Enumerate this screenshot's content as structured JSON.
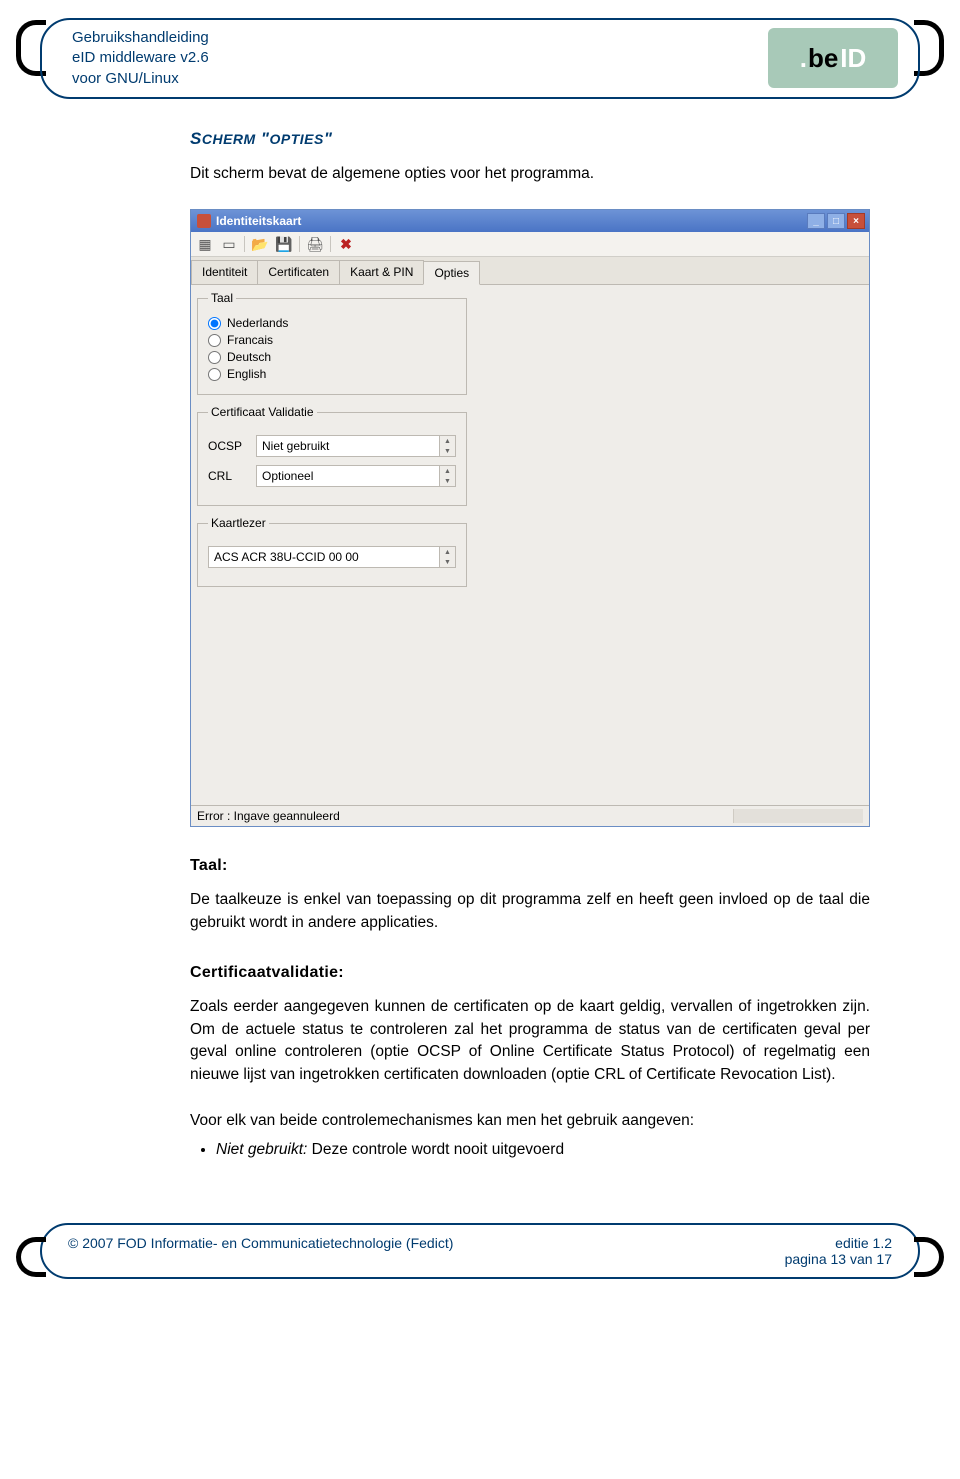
{
  "header": {
    "line1": "Gebruikshandleiding",
    "line2": "eID middleware v2.6",
    "line3": "voor GNU/Linux",
    "logo_be": "be",
    "logo_id": "ID",
    "logo_dot": "."
  },
  "section": {
    "title_caps": "S",
    "title_rest_sc": "CHERM",
    "title_quote": " \"",
    "title_opt_caps": "OPTIES",
    "title_endquote": "\"",
    "intro": "Dit scherm bevat de algemene opties voor het programma."
  },
  "app": {
    "title": "Identiteitskaart",
    "winbtn_min": "_",
    "winbtn_max": "□",
    "winbtn_close": "×",
    "tabs": [
      "Identiteit",
      "Certificaten",
      "Kaart & PIN",
      "Opties"
    ],
    "active_tab_index": 3,
    "groups": {
      "taal": {
        "legend": "Taal",
        "options": [
          "Nederlands",
          "Francais",
          "Deutsch",
          "English"
        ],
        "selected_index": 0
      },
      "certval": {
        "legend": "Certificaat Validatie",
        "rows": [
          {
            "label": "OCSP",
            "value": "Niet gebruikt"
          },
          {
            "label": "CRL",
            "value": "Optioneel"
          }
        ]
      },
      "reader": {
        "legend": "Kaartlezer",
        "value": "ACS ACR 38U-CCID 00 00"
      }
    },
    "statusbar": "Error : Ingave geannuleerd"
  },
  "body": {
    "taal_heading": "Taal:",
    "taal_text": "De taalkeuze is enkel van toepassing op dit programma zelf en heeft geen invloed op de taal die gebruikt wordt in andere applicaties.",
    "cert_heading": "Certificaatvalidatie:",
    "cert_p1": "Zoals eerder aangegeven kunnen de certificaten op de kaart geldig, vervallen of ingetrokken zijn. Om de actuele status te controleren zal het programma de status van de certificaten geval per geval online controleren (optie OCSP of Online Certificate Status Protocol) of regelmatig een nieuwe lijst van ingetrokken certificaten downloaden (optie CRL of Certificate Revocation List).",
    "cert_p2": "Voor elk van beide controlemechanismes kan men het gebruik aangeven:",
    "bullet_em": "Niet gebruikt:",
    "bullet_rest": " Deze controle wordt nooit uitgevoerd"
  },
  "footer": {
    "left": "© 2007  FOD Informatie- en Communicatietechnologie (Fedict)",
    "right1": "editie 1.2",
    "right2": "pagina 13 van 17"
  }
}
